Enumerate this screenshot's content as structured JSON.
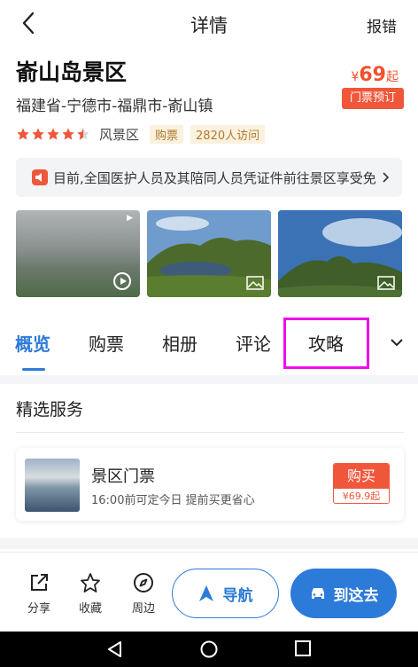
{
  "nav": {
    "title": "详情",
    "report_label": "报错"
  },
  "spot": {
    "name": "嵛山岛景区",
    "address": "福建省-宁德市-福鼎市-嵛山镇",
    "price_currency": "¥",
    "price_value": "69",
    "price_suffix": "起",
    "ticket_button": "门票预订",
    "rating_stars": 4.5,
    "level": "风景区",
    "tags": [
      "购票",
      "2820人访问"
    ]
  },
  "notice": {
    "text": "目前,全国医护人员及其陪同人员凭证件前往景区享受免票"
  },
  "gallery": {
    "video_badge": "▶",
    "photos": [
      "photo-video",
      "photo-lake",
      "photo-hills"
    ]
  },
  "tabs": [
    "概览",
    "购票",
    "相册",
    "评论",
    "攻略"
  ],
  "services": {
    "title": "精选服务",
    "item": {
      "name": "景区门票",
      "desc": "16:00前可定今日 提前买更省心",
      "buy_label": "购买",
      "buy_price": "¥69.9起"
    }
  },
  "bottom": {
    "share": "分享",
    "favorite": "收藏",
    "nearby": "周边",
    "navigate": "导航",
    "go_here": "到这去"
  },
  "colors": {
    "accent": "#2d7bd8",
    "price": "#f0522d",
    "highlight": "#ef0dea"
  }
}
